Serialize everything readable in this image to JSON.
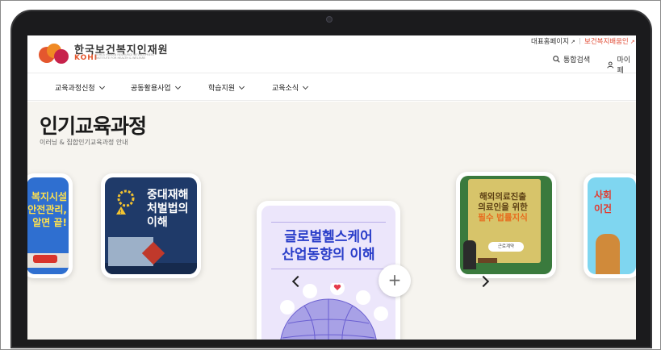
{
  "header": {
    "logo_title": "한국보건복지인재원",
    "logo_en": "KOHI",
    "logo_sub": "KOREA HUMAN RESOURCE DEVELOPMENT INSTITUTE FOR HEALTH & WELFARE",
    "util_links": [
      "대표홈페이지",
      "보건복지배움인"
    ],
    "search_label": "통합검색",
    "mypage_label": "마이페"
  },
  "nav": {
    "items": [
      "교육과정신청",
      "공동활용사업",
      "학습지원",
      "교육소식"
    ]
  },
  "section": {
    "title": "인기교육과정",
    "desc": "이러닝 & 집합인기교육과정 안내"
  },
  "cards": {
    "left_title": "복지시설\n안전관리,\n알면 끝!",
    "card2_title": "중대재해\n처벌법의\n이해",
    "card3_title": "글로벌헬스케어\n산업동향의 이해",
    "card4_title_a": "해외의료진출",
    "card4_title_b": "의료인을 위한",
    "card4_title_c": "필수 법률지식",
    "card4_btn": "근로계약",
    "right_title": "사회\n이건"
  },
  "controls": {
    "plus": "+"
  },
  "colors": {
    "accent": "#e14c36",
    "background": "#f6f4ef",
    "card3_title": "#2a3ec9"
  }
}
